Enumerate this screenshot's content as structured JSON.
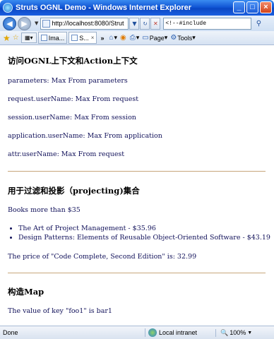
{
  "window": {
    "title": "Struts OGNL Demo - Windows Internet Explorer"
  },
  "nav": {
    "address": "http://localhost:8080/Strut",
    "search": "<!--#include"
  },
  "tabs": {
    "items": [
      {
        "label": "Ima..."
      },
      {
        "label": "S..."
      }
    ],
    "more": "»",
    "page_label": "Page",
    "tools_label": "Tools"
  },
  "content": {
    "section1_title": "访问OGNL上下文和Action上下文",
    "lines1": [
      "parameters: Max From parameters",
      "request.userName: Max From request",
      "session.userName: Max From session",
      "application.userName: Max From application",
      "attr.userName: Max From request"
    ],
    "section2_title": "用于过滤和投影（projecting)集合",
    "books_intro": "Books more than $35",
    "books": [
      "The Art of Project Management - $35.96",
      "Design Patterns: Elements of Reusable Object-Oriented Software - $43.19"
    ],
    "price_line": "The price of \"Code Complete, Second Edition\" is: 32.99",
    "section3_title": "构造Map",
    "map_line": "The value of key \"foo1\" is bar1"
  },
  "status": {
    "text": "Done",
    "zone": "Local intranet",
    "zoom": "100%"
  }
}
